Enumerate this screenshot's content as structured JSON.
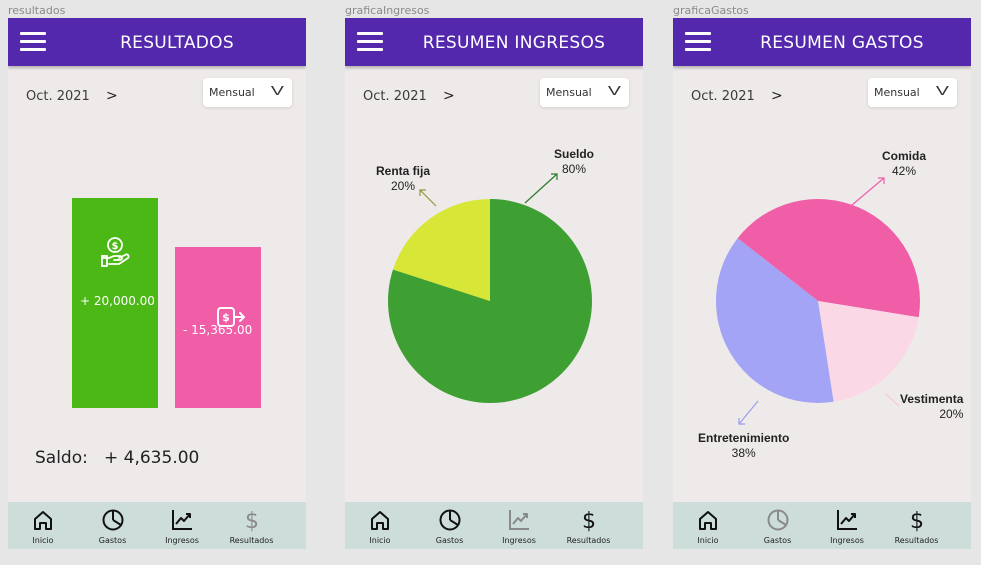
{
  "colors": {
    "appbar": "#5328ad",
    "income_green": "#4cb815",
    "expense_pink": "#f05ea8",
    "pie_green": "#3ea033",
    "pie_yellow": "#d7e637",
    "pie_pink": "#f05ea8",
    "pie_lightpink": "#fad8e6",
    "pie_lavender": "#a3a4f5",
    "nav_bg": "#cdddda"
  },
  "common": {
    "period": "Oct. 2021",
    "period_next": ">",
    "frequency": "Mensual",
    "dropdown_arrow": "V",
    "nav": [
      {
        "label": "Inicio",
        "icon": "home-icon"
      },
      {
        "label": "Gastos",
        "icon": "pie-chart-icon"
      },
      {
        "label": "Ingresos",
        "icon": "trend-chart-icon"
      },
      {
        "label": "Resultados",
        "icon": "dollar-icon"
      }
    ]
  },
  "screens": {
    "resultados": {
      "frame_label": "resultados",
      "title": "RESULTADOS",
      "income_amount": "+ 20,000.00",
      "income_icon": "money-hand-icon",
      "expense_amount": "- 15,365.00",
      "expense_icon": "money-out-icon",
      "saldo_label": "Saldo:",
      "saldo_value": "+ 4,635.00",
      "active_nav": "Resultados"
    },
    "ingresos": {
      "frame_label": "graficaIngresos",
      "title": "RESUMEN INGRESOS",
      "active_nav": "Ingresos"
    },
    "gastos": {
      "frame_label": "graficaGastos",
      "title": "RESUMEN GASTOS",
      "active_nav": "Gastos"
    }
  },
  "chart_data": [
    {
      "type": "bar",
      "categories": [
        "Ingresos",
        "Gastos"
      ],
      "values": [
        20000,
        15365
      ],
      "value_labels": [
        "+ 20,000.00",
        "- 15,365.00"
      ]
    },
    {
      "type": "pie",
      "slices": [
        {
          "label": "Sueldo",
          "value": 80,
          "pct_label": "80%"
        },
        {
          "label": "Renta fija",
          "value": 20,
          "pct_label": "20%"
        }
      ]
    },
    {
      "type": "pie",
      "slices": [
        {
          "label": "Comida",
          "value": 42,
          "pct_label": "42%"
        },
        {
          "label": "Vestimenta",
          "value": 20,
          "pct_label": "20%"
        },
        {
          "label": "Entretenimiento",
          "value": 38,
          "pct_label": "38%"
        }
      ]
    }
  ]
}
